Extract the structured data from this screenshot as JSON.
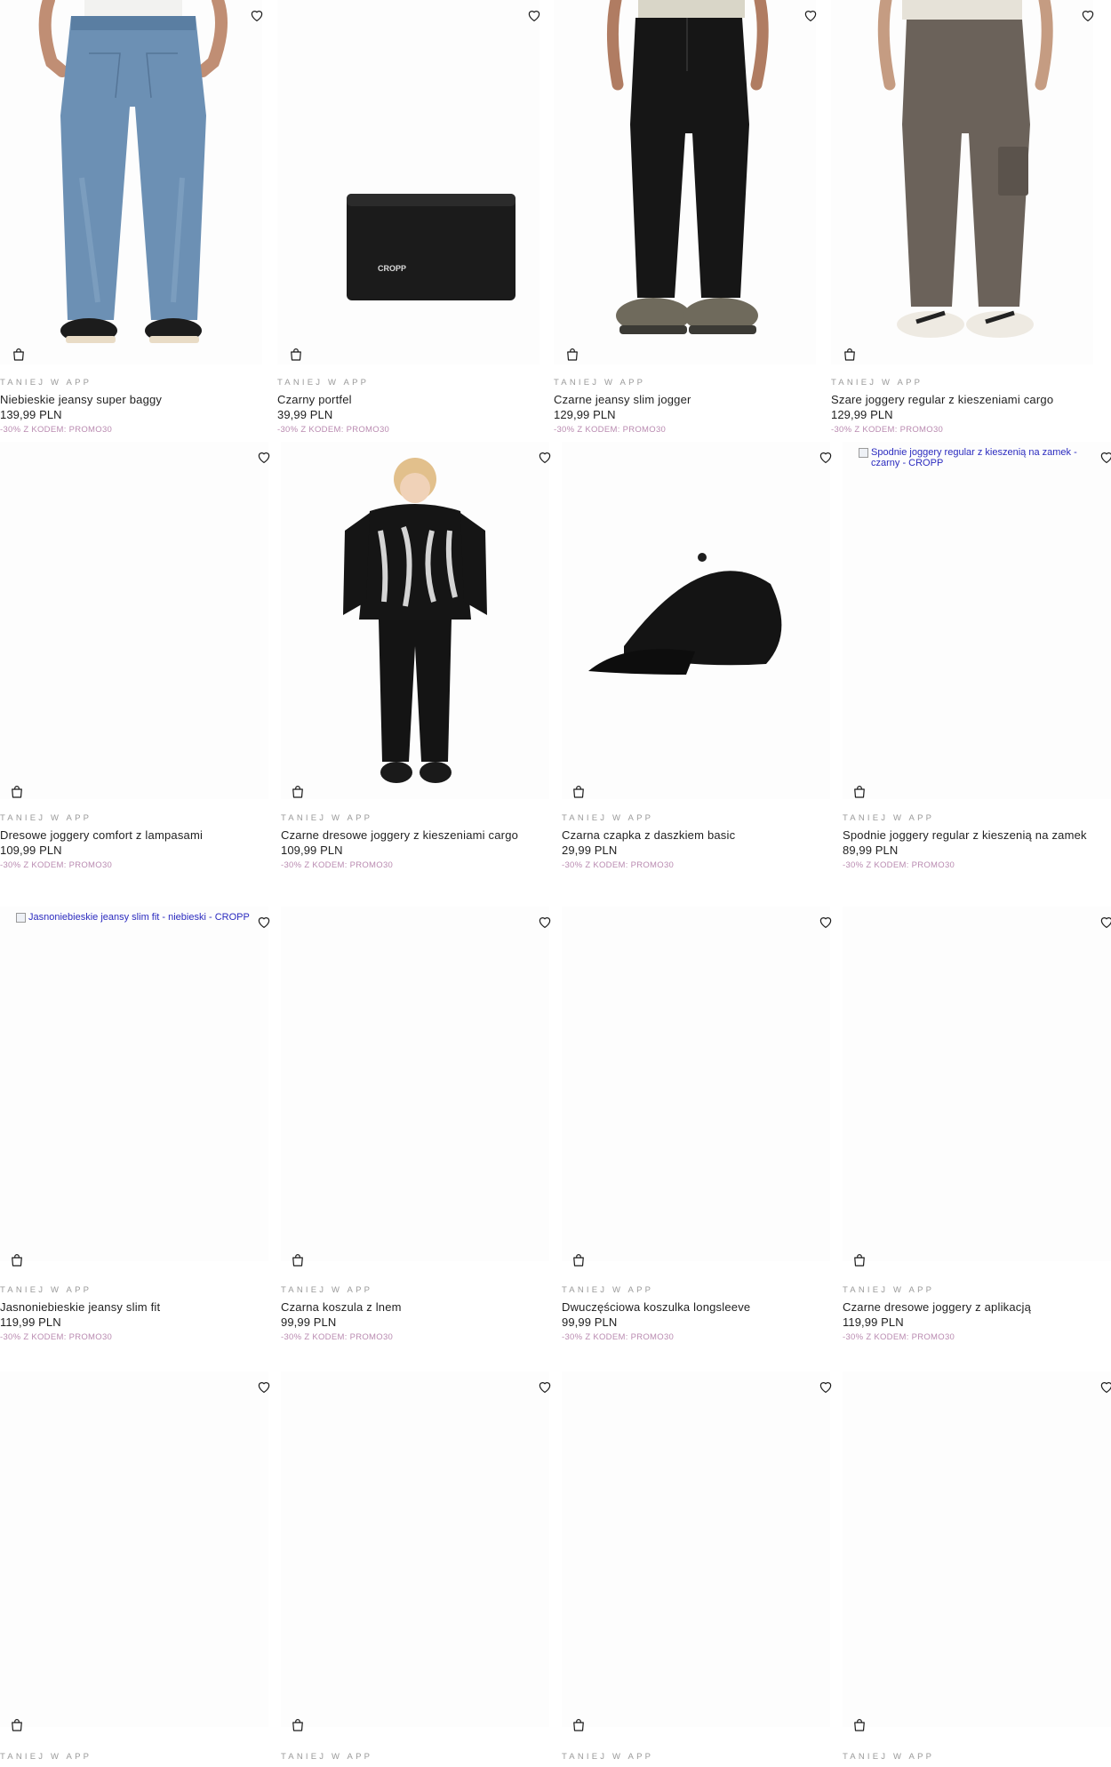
{
  "products": [
    {
      "badge": "TANIEJ W APP",
      "name": "Niebieskie jeansy super baggy",
      "price": "139,99 PLN",
      "promo": "-30% Z KODEM: PROMO30",
      "image": "blue-baggy-jeans"
    },
    {
      "badge": "TANIEJ W APP",
      "name": "Czarny portfel",
      "price": "39,99 PLN",
      "promo": "-30% Z KODEM: PROMO30",
      "image": "black-wallet",
      "logo": "CROPP"
    },
    {
      "badge": "TANIEJ W APP",
      "name": "Czarne jeansy slim jogger",
      "price": "129,99 PLN",
      "promo": "-30% Z KODEM: PROMO30",
      "image": "black-jogger-jeans"
    },
    {
      "badge": "TANIEJ W APP",
      "name": "Szare joggery regular z kieszeniami cargo",
      "price": "129,99 PLN",
      "promo": "-30% Z KODEM: PROMO30",
      "image": "grey-cargo-joggers"
    },
    {
      "badge": "TANIEJ W APP",
      "name": "Dresowe joggery comfort z lampasami",
      "price": "109,99 PLN",
      "promo": "-30% Z KODEM: PROMO30",
      "image": "blank"
    },
    {
      "badge": "TANIEJ W APP",
      "name": "Czarne dresowe joggery z kieszeniami cargo",
      "price": "109,99 PLN",
      "promo": "-30% Z KODEM: PROMO30",
      "image": "model-black-outfit"
    },
    {
      "badge": "TANIEJ W APP",
      "name": "Czarna czapka z daszkiem basic",
      "price": "29,99 PLN",
      "promo": "-30% Z KODEM: PROMO30",
      "image": "black-cap"
    },
    {
      "badge": "TANIEJ W APP",
      "name": "Spodnie joggery regular z kieszenią na zamek",
      "price": "89,99 PLN",
      "promo": "-30% Z KODEM: PROMO30",
      "image": "broken",
      "alt": "Spodnie joggery regular z kieszenią na zamek - czarny - CROPP"
    },
    {
      "badge": "TANIEJ W APP",
      "name": "Jasnoniebieskie jeansy slim fit",
      "price": "119,99 PLN",
      "promo": "-30% Z KODEM: PROMO30",
      "image": "broken",
      "alt": "Jasnoniebieskie jeansy slim fit - niebieski - CROPP"
    },
    {
      "badge": "TANIEJ W APP",
      "name": "Czarna koszula z lnem",
      "price": "99,99 PLN",
      "promo": "-30% Z KODEM: PROMO30",
      "image": "blank"
    },
    {
      "badge": "TANIEJ W APP",
      "name": "Dwuczęściowa koszulka longsleeve",
      "price": "99,99 PLN",
      "promo": "-30% Z KODEM: PROMO30",
      "image": "blank"
    },
    {
      "badge": "TANIEJ W APP",
      "name": "Czarne dresowe joggery z aplikacją",
      "price": "119,99 PLN",
      "promo": "-30% Z KODEM: PROMO30",
      "image": "blank"
    },
    {
      "badge": "TANIEJ W APP",
      "image": "blank"
    },
    {
      "badge": "TANIEJ W APP",
      "image": "blank"
    },
    {
      "badge": "TANIEJ W APP",
      "image": "blank"
    },
    {
      "badge": "TANIEJ W APP",
      "image": "blank"
    }
  ],
  "icons": {
    "favorite": "heart-icon",
    "cart": "shopping-bag-icon"
  },
  "colors": {
    "promo": "#b98ab0",
    "badge": "#9a9a9a",
    "text": "#1f1f1f"
  }
}
